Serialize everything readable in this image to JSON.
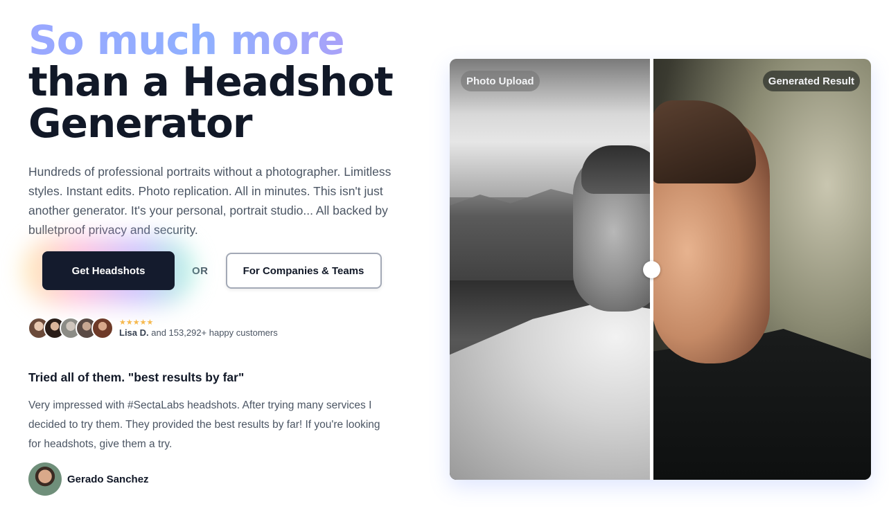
{
  "hero": {
    "headline_gradient": "So much more",
    "headline_line2": "than a Headshot",
    "headline_line3": "Generator",
    "lead": "Hundreds of professional portraits without a photographer. Limitless styles. Instant edits. Photo replication. All in minutes. This isn't just another generator. It's your personal, portrait studio... All backed by bulletproof privacy and security."
  },
  "cta": {
    "primary_label": "Get Headshots",
    "or_label": "OR",
    "secondary_label": "For Companies & Teams"
  },
  "social_proof": {
    "stars": "★★★★★",
    "customer_name": "Lisa D.",
    "customers_suffix": "and 153,292+ happy customers"
  },
  "testimonial": {
    "title": "Tried all of them. \"best results by far\"",
    "body": "Very impressed with #SectaLabs headshots. After trying many services I decided to try them. They provided the best results by far! If you're looking for headshots, give them a try.",
    "author": "Gerado Sanchez"
  },
  "comparison": {
    "left_tag": "Photo Upload",
    "right_tag": "Generated Result"
  },
  "colors": {
    "primary_button": "#141b2d",
    "gradient_start": "#9aa7ff",
    "gradient_end": "#b69af5",
    "star": "#f6b94d"
  }
}
